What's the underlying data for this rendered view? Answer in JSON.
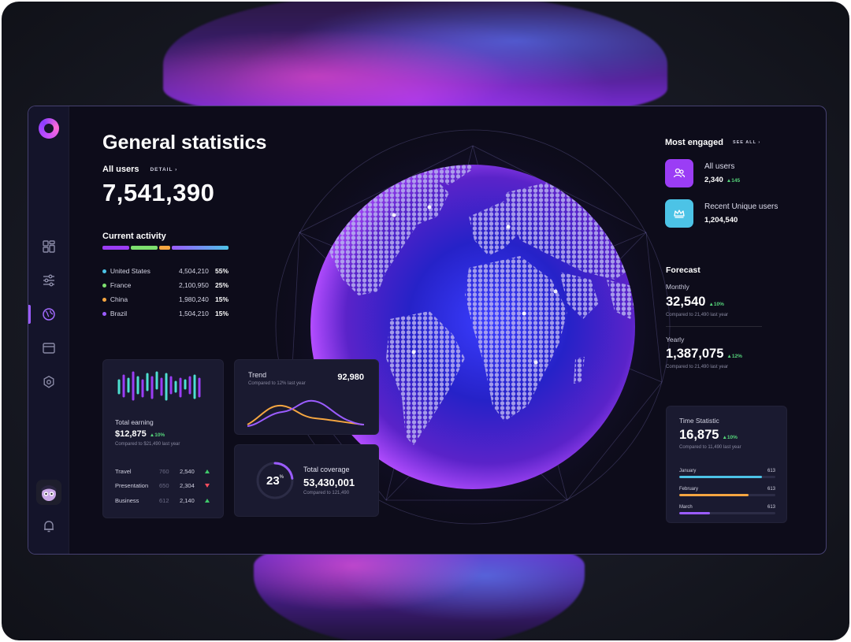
{
  "colors": {
    "accent_purple": "#9b5cff",
    "cyan": "#4cc3e6",
    "green": "#55d47a",
    "orange": "#f5a641",
    "red": "#ff4d5e"
  },
  "sidebar": {
    "icons": [
      "dashboard-icon",
      "sliders-icon",
      "globe-icon",
      "card-icon",
      "settings-icon",
      "bell-icon"
    ],
    "active": "globe-icon"
  },
  "header": {
    "title": "General statistics",
    "all_users_label": "All users",
    "detail_link": "DETAIL ›",
    "all_users_value": "7,541,390"
  },
  "activity": {
    "title": "Current activity",
    "rows": [
      {
        "country": "United States",
        "value": "4,504,210",
        "pct": "55%",
        "color": "#4cc3e6"
      },
      {
        "country": "France",
        "value": "2,100,950",
        "pct": "25%",
        "color": "#7ee06f"
      },
      {
        "country": "China",
        "value": "1,980,240",
        "pct": "15%",
        "color": "#f5a641"
      },
      {
        "country": "Brazil",
        "value": "1,504,210",
        "pct": "15%",
        "color": "#9b5cff"
      }
    ]
  },
  "earning": {
    "label": "Total earning",
    "value": "$12,875",
    "delta": "▲10%",
    "note": "Compared to $21,490 last year",
    "rows": [
      {
        "name": "Travel",
        "a": "760",
        "b": "2,540",
        "trend": "up"
      },
      {
        "name": "Presentation",
        "a": "650",
        "b": "2,304",
        "trend": "down"
      },
      {
        "name": "Business",
        "a": "612",
        "b": "2,140",
        "trend": "up"
      }
    ]
  },
  "trend": {
    "label": "Trend",
    "note": "Compared to 12% last year",
    "value": "92,980"
  },
  "coverage": {
    "percent_number": "23",
    "percent_sign": "%",
    "fraction": 0.23,
    "label": "Total coverage",
    "value": "53,430,001",
    "note": "Compared to 121,490"
  },
  "engaged": {
    "title": "Most engaged",
    "see_all": "SEE ALL ›",
    "items": [
      {
        "name": "All users",
        "value": "2,340",
        "delta": "▲145",
        "icon": "users-icon",
        "color": "#9b3df5"
      },
      {
        "name": "Recent Unique users",
        "value": "1,204,540",
        "delta": "",
        "icon": "crown-icon",
        "color": "#4cc3e6"
      }
    ]
  },
  "forecast": {
    "title": "Forecast",
    "monthly_label": "Monthly",
    "monthly_value": "32,540",
    "monthly_delta": "▲10%",
    "monthly_note": "Compared to 21,490 last year",
    "yearly_label": "Yearly",
    "yearly_value": "1,387,075",
    "yearly_delta": "▲12%",
    "yearly_note": "Compared to 21,490 last year"
  },
  "time_statistic": {
    "label": "Time Statistic",
    "value": "16,875",
    "delta": "▲10%",
    "note": "Compared to 11,490 last year",
    "rows": [
      {
        "month": "January",
        "value": "613",
        "fraction": 0.86,
        "color": "#4cc3e6"
      },
      {
        "month": "February",
        "value": "613",
        "fraction": 0.72,
        "color": "#f5a641"
      },
      {
        "month": "March",
        "value": "613",
        "fraction": 0.32,
        "color": "#9b5cff"
      }
    ]
  }
}
